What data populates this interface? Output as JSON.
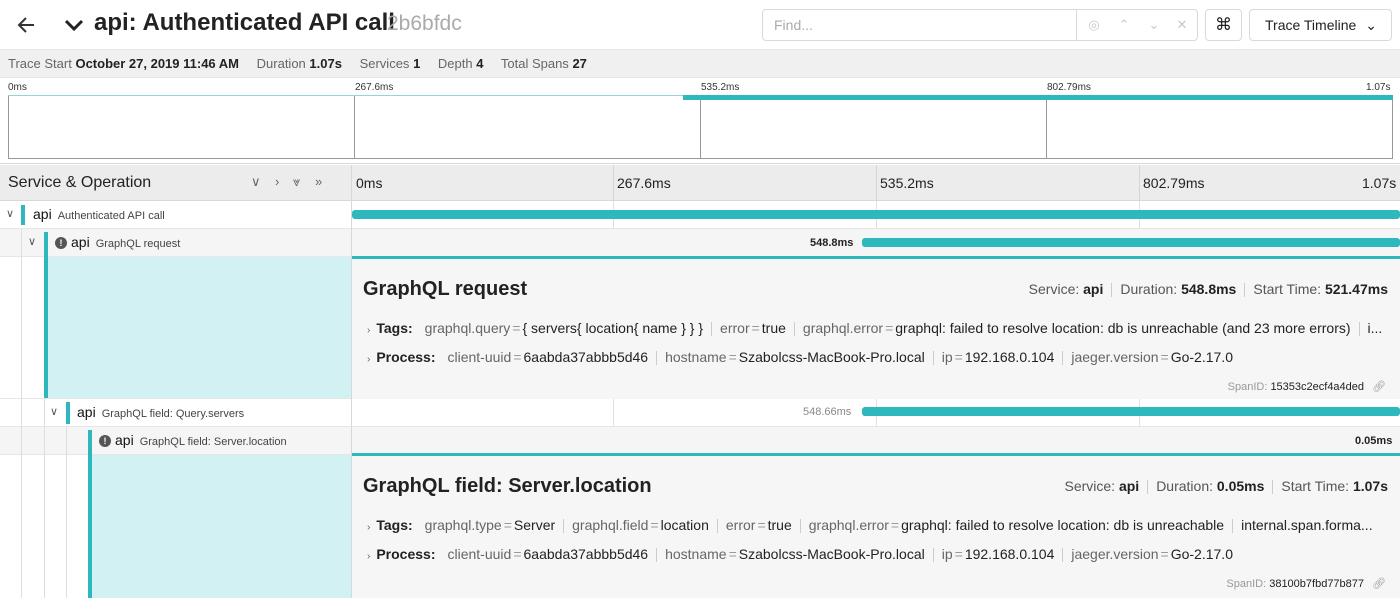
{
  "header": {
    "title": "api: Authenticated API call",
    "trace_id": "2b6bfdc",
    "find_placeholder": "Find...",
    "view_label": "Trace Timeline"
  },
  "summary": {
    "trace_start_label": "Trace Start",
    "trace_start": "October 27, 2019 11:46 AM",
    "duration_label": "Duration",
    "duration": "1.07s",
    "services_label": "Services",
    "services": "1",
    "depth_label": "Depth",
    "depth": "4",
    "total_spans_label": "Total Spans",
    "total_spans": "27"
  },
  "ticks": [
    "0ms",
    "267.6ms",
    "535.2ms",
    "802.79ms",
    "1.07s"
  ],
  "column_header": "Service & Operation",
  "spans": [
    {
      "service": "api",
      "operation": "Authenticated API call"
    },
    {
      "service": "api",
      "operation": "GraphQL request",
      "label": "548.8ms"
    },
    {
      "service": "api",
      "operation": "GraphQL field: Query.servers",
      "label": "548.66ms"
    },
    {
      "service": "api",
      "operation": "GraphQL field: Server.location",
      "label": "0.05ms"
    }
  ],
  "detail1": {
    "title": "GraphQL request",
    "service_label": "Service:",
    "service": "api",
    "duration_label": "Duration:",
    "duration": "548.8ms",
    "start_label": "Start Time:",
    "start": "521.47ms",
    "tags_label": "Tags:",
    "tags": [
      {
        "k": "graphql.query",
        "v": "{ servers{ location{ name } } }"
      },
      {
        "k": "error",
        "v": "true"
      },
      {
        "k": "graphql.error",
        "v": "graphql: failed to resolve location: db is unreachable (and 23 more errors)"
      }
    ],
    "tags_more": "i...",
    "process_label": "Process:",
    "process": [
      {
        "k": "client-uuid",
        "v": "6aabda37abbb5d46"
      },
      {
        "k": "hostname",
        "v": "Szabolcss-MacBook-Pro.local"
      },
      {
        "k": "ip",
        "v": "192.168.0.104"
      },
      {
        "k": "jaeger.version",
        "v": "Go-2.17.0"
      }
    ],
    "spanid_label": "SpanID:",
    "spanid": "15353c2ecf4a4ded"
  },
  "detail2": {
    "title": "GraphQL field: Server.location",
    "service_label": "Service:",
    "service": "api",
    "duration_label": "Duration:",
    "duration": "0.05ms",
    "start_label": "Start Time:",
    "start": "1.07s",
    "tags_label": "Tags:",
    "tags": [
      {
        "k": "graphql.type",
        "v": "Server"
      },
      {
        "k": "graphql.field",
        "v": "location"
      },
      {
        "k": "error",
        "v": "true"
      },
      {
        "k": "graphql.error",
        "v": "graphql: failed to resolve location: db is unreachable"
      }
    ],
    "tags_more": "internal.span.forma...",
    "process_label": "Process:",
    "process": [
      {
        "k": "client-uuid",
        "v": "6aabda37abbb5d46"
      },
      {
        "k": "hostname",
        "v": "Szabolcss-MacBook-Pro.local"
      },
      {
        "k": "ip",
        "v": "192.168.0.104"
      },
      {
        "k": "jaeger.version",
        "v": "Go-2.17.0"
      }
    ],
    "spanid_label": "SpanID:",
    "spanid": "38100b7fbd77b877"
  },
  "colors": {
    "accent": "#2eb7bd",
    "highlight": "#d1f1f2"
  },
  "icons": [
    "back-arrow-icon",
    "chevron-down-icon",
    "keyboard-command-icon",
    "error-icon",
    "link-icon"
  ]
}
